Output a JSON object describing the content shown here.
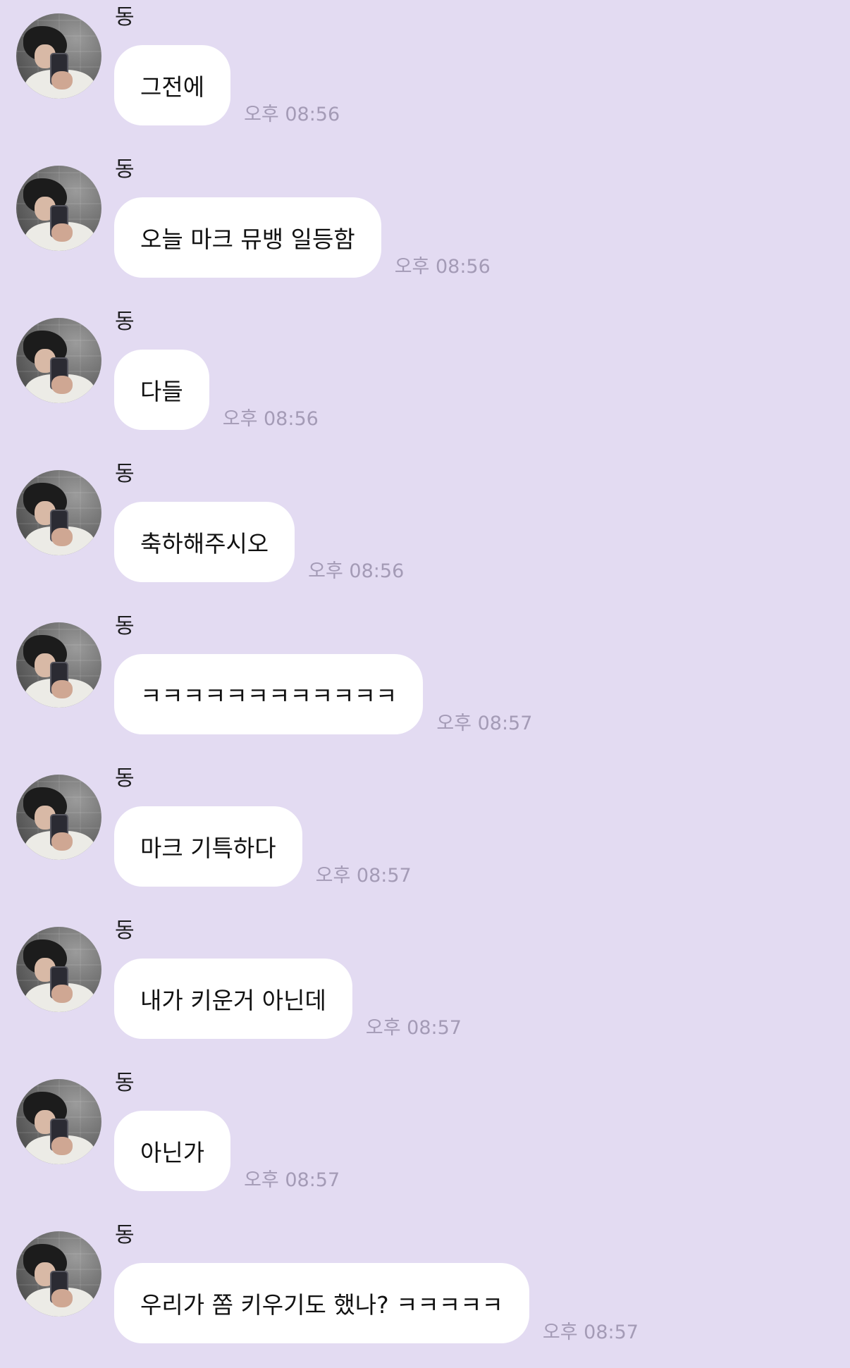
{
  "messages": [
    {
      "sender": "동",
      "text": "그전에",
      "time": "오후 08:56"
    },
    {
      "sender": "동",
      "text": "오늘 마크 뮤뱅 일등함",
      "time": "오후 08:56"
    },
    {
      "sender": "동",
      "text": "다들",
      "time": "오후 08:56"
    },
    {
      "sender": "동",
      "text": "축하해주시오",
      "time": "오후 08:56"
    },
    {
      "sender": "동",
      "text": "ㅋㅋㅋㅋㅋㅋㅋㅋㅋㅋㅋㅋ",
      "time": "오후 08:57"
    },
    {
      "sender": "동",
      "text": "마크 기특하다",
      "time": "오후 08:57"
    },
    {
      "sender": "동",
      "text": "내가 키운거 아닌데",
      "time": "오후 08:57"
    },
    {
      "sender": "동",
      "text": "아닌가",
      "time": "오후 08:57"
    },
    {
      "sender": "동",
      "text": "우리가 쫌 키우기도 했나? ㅋㅋㅋㅋㅋ",
      "time": "오후 08:57"
    }
  ],
  "colors": {
    "background": "#e3dbf2",
    "bubble": "#ffffff",
    "timestamp": "#a49bb6"
  },
  "icons": {
    "avatar": "profile-photo"
  }
}
